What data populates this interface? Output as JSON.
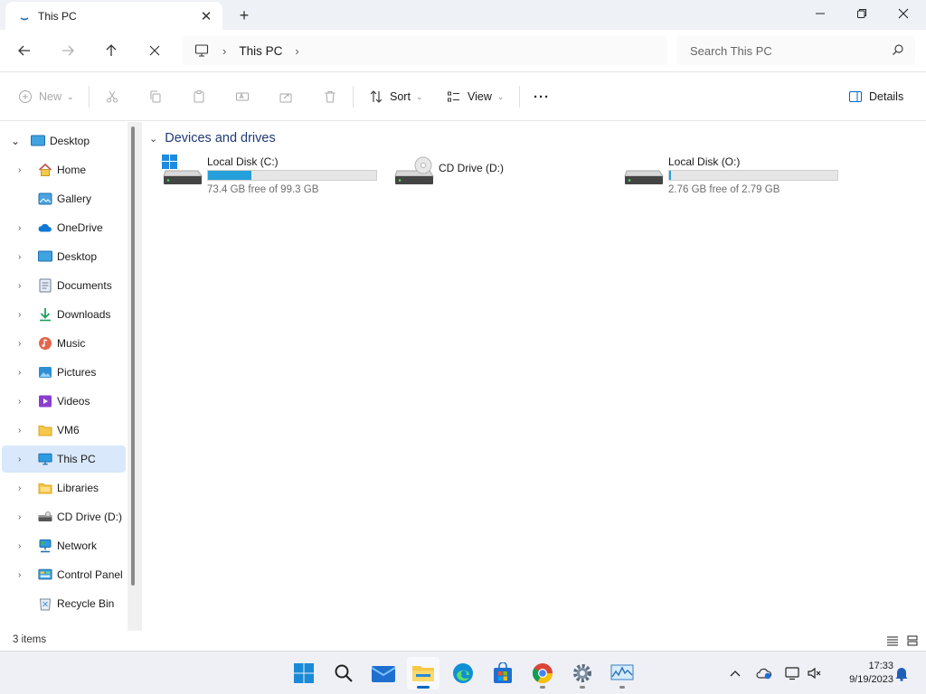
{
  "window": {
    "tab_title": "This PC",
    "new_tab_symbol": "+",
    "close_tab_symbol": "✕"
  },
  "address": {
    "breadcrumb": [
      "This PC"
    ],
    "search_placeholder": "Search This PC"
  },
  "commandbar": {
    "new_label": "New",
    "sort_label": "Sort",
    "view_label": "View",
    "more_label": "···",
    "details_label": "Details"
  },
  "sidebar": {
    "items": [
      {
        "label": "Desktop",
        "icon": "desktop-icon"
      },
      {
        "label": "Home",
        "icon": "home-icon"
      },
      {
        "label": "Gallery",
        "icon": "gallery-icon"
      },
      {
        "label": "OneDrive",
        "icon": "onedrive-icon"
      },
      {
        "label": "Desktop",
        "icon": "desktop-icon"
      },
      {
        "label": "Documents",
        "icon": "documents-icon"
      },
      {
        "label": "Downloads",
        "icon": "downloads-icon"
      },
      {
        "label": "Music",
        "icon": "music-icon"
      },
      {
        "label": "Pictures",
        "icon": "pictures-icon"
      },
      {
        "label": "Videos",
        "icon": "videos-icon"
      },
      {
        "label": "VM6",
        "icon": "folder-icon"
      },
      {
        "label": "This PC",
        "icon": "pc-icon",
        "selected": true
      },
      {
        "label": "Libraries",
        "icon": "libraries-icon"
      },
      {
        "label": "CD Drive (D:)",
        "icon": "cd-drive-icon"
      },
      {
        "label": "Network",
        "icon": "network-icon"
      },
      {
        "label": "Control Panel",
        "icon": "control-panel-icon"
      },
      {
        "label": "Recycle Bin",
        "icon": "recycle-bin-icon"
      }
    ]
  },
  "content": {
    "group_header": "Devices and drives",
    "drives": [
      {
        "name": "Local Disk (C:)",
        "free_text": "73.4 GB free of 99.3 GB",
        "used_fraction": 0.26,
        "icon": "windows-drive-icon"
      },
      {
        "name": "CD Drive (D:)",
        "icon": "cd-drive-icon"
      },
      {
        "name": "Local Disk (O:)",
        "free_text": "2.76 GB free of 2.79 GB",
        "used_fraction": 0.01,
        "icon": "drive-icon"
      }
    ]
  },
  "status": {
    "item_count": "3 items"
  },
  "taskbar": {
    "apps": [
      "start-icon",
      "search-icon",
      "mail-icon",
      "file-explorer-icon",
      "edge-icon",
      "store-icon",
      "chrome-icon",
      "settings-icon",
      "resource-monitor-icon"
    ],
    "clock_time": "17:33",
    "clock_date": "9/19/2023"
  },
  "colors": {
    "accent": "#0067c0",
    "drive_bar_fill": "#26a0da",
    "selected_bg": "#d9e8fb"
  }
}
